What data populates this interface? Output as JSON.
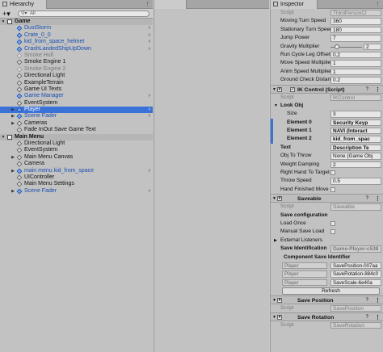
{
  "hierarchy": {
    "tab_label": "Hierarchy",
    "search_placeholder": "All",
    "rows": [
      {
        "label": "Game",
        "style": "scene",
        "indent": 0,
        "arrow": "▼"
      },
      {
        "label": "DustStorm",
        "style": "prefab",
        "indent": 1,
        "arrow": "",
        "chev": "›"
      },
      {
        "label": "Crate_0_0",
        "style": "prefab",
        "indent": 1,
        "arrow": "",
        "chev": "›"
      },
      {
        "label": "kid_from_space_helmet",
        "style": "prefab",
        "indent": 1,
        "arrow": "",
        "chev": "›"
      },
      {
        "label": "CrashLandedShipUpDown",
        "style": "prefab",
        "indent": 1,
        "arrow": "",
        "chev": "›"
      },
      {
        "label": "Smoke Hull",
        "style": "dim",
        "indent": 1,
        "arrow": "",
        "chev": ""
      },
      {
        "label": "Smoke Engine 1",
        "style": "normal",
        "indent": 1,
        "arrow": "",
        "chev": ""
      },
      {
        "label": "Smoke Engine 2",
        "style": "dim",
        "indent": 1,
        "arrow": "",
        "chev": ""
      },
      {
        "label": "Directional Light",
        "style": "normal",
        "indent": 1,
        "arrow": "",
        "chev": ""
      },
      {
        "label": "ExampleTerrain",
        "style": "normal",
        "indent": 1,
        "arrow": "",
        "chev": ""
      },
      {
        "label": "Game UI Texts",
        "style": "normal",
        "indent": 1,
        "arrow": "",
        "chev": ""
      },
      {
        "label": "Game Manager",
        "style": "prefab",
        "indent": 1,
        "arrow": "",
        "chev": "›"
      },
      {
        "label": "EventSystem",
        "style": "normal",
        "indent": 1,
        "arrow": "",
        "chev": ""
      },
      {
        "label": "Player",
        "style": "selected",
        "indent": 1,
        "arrow": "▶",
        "chev": "›"
      },
      {
        "label": "Scene Fader",
        "style": "prefab",
        "indent": 1,
        "arrow": "▶",
        "chev": "›"
      },
      {
        "label": "Cameras",
        "style": "normal",
        "indent": 1,
        "arrow": "▶",
        "chev": ""
      },
      {
        "label": "Fade InOut Save Game Text",
        "style": "normal",
        "indent": 1,
        "arrow": "",
        "chev": ""
      },
      {
        "label": "Main Menu",
        "style": "scene",
        "indent": 0,
        "arrow": "▼"
      },
      {
        "label": "Directional Light",
        "style": "normal",
        "indent": 1,
        "arrow": "",
        "chev": ""
      },
      {
        "label": "EventSystem",
        "style": "normal",
        "indent": 1,
        "arrow": "",
        "chev": ""
      },
      {
        "label": "Main Menu Canvas",
        "style": "normal",
        "indent": 1,
        "arrow": "▶",
        "chev": ""
      },
      {
        "label": "Camera",
        "style": "normal",
        "indent": 1,
        "arrow": "",
        "chev": ""
      },
      {
        "label": "main menu kid_from_space",
        "style": "prefab",
        "indent": 1,
        "arrow": "▶",
        "chev": "›"
      },
      {
        "label": "UIController",
        "style": "normal",
        "indent": 1,
        "arrow": "",
        "chev": ""
      },
      {
        "label": "Main Menu Settings",
        "style": "normal",
        "indent": 1,
        "arrow": "",
        "chev": ""
      },
      {
        "label": "Scene Fader",
        "style": "prefab",
        "indent": 1,
        "arrow": "▶",
        "chev": "›"
      }
    ]
  },
  "inspector": {
    "tab_label": "Inspector",
    "third_person": {
      "script_label": "Script",
      "script_value": "ThirdPersonCl",
      "fields": [
        {
          "k": "Moving Turn Speed",
          "v": "360"
        },
        {
          "k": "Stationary Turn Speed",
          "v": "180"
        },
        {
          "k": "Jump Power",
          "v": "7"
        }
      ],
      "gravity_label": "Gravity Multiplier",
      "gravity_value": "2",
      "gravity_fraction": 0.2,
      "fields2": [
        {
          "k": "Run Cycle Leg Offset",
          "v": "0.2"
        },
        {
          "k": "Move Speed Multiplier",
          "v": "1"
        },
        {
          "k": "Anim Speed Multiplier",
          "v": "1"
        },
        {
          "k": "Ground Check Distance",
          "v": "0.2"
        }
      ]
    },
    "ik_control": {
      "title": "IK Control (Script)",
      "script_label": "Script",
      "script_value": "IKControl",
      "look_obj": "Look Obj",
      "size_label": "Size",
      "size_value": "3",
      "elements": [
        {
          "k": "Element 0",
          "v": "Security Keyp"
        },
        {
          "k": "Element 1",
          "v": "NAVI (Interact"
        },
        {
          "k": "Element 2",
          "v": "kid_from_spac"
        }
      ],
      "text_label": "Text",
      "text_value": "Description Te",
      "obj_to_throw_label": "Obj To Throw",
      "obj_to_throw_value": "None (Game Obj",
      "weight_label": "Weight Damping",
      "weight_value": "2",
      "right_hand_label": "Right Hand To Target",
      "throw_speed_label": "Throw Speed",
      "throw_speed_value": "0.5",
      "hand_finished_label": "Hand Finished Move"
    },
    "saveable": {
      "title": "Saveable",
      "script_label": "Script",
      "script_value": "Saveable",
      "save_config": "Save configuration",
      "load_once": "Load Once",
      "manual_save_load": "Manual Save Load",
      "external_listeners": "External Listeners",
      "save_identification_label": "Save Identification",
      "save_identification_value": "Game-Player-c538",
      "component_save_identifier": "Component Save Identifier",
      "components": [
        {
          "obj": "Player",
          "id": "SavePosition-007aa"
        },
        {
          "obj": "Player",
          "id": "SaveRotation-884c0"
        },
        {
          "obj": "Player",
          "id": "SaveScale-6e40a"
        }
      ],
      "refresh": "Refresh"
    },
    "save_position": {
      "title": "Save Position",
      "script_label": "Script",
      "script_value": "SavePosition"
    },
    "save_rotation": {
      "title": "Save Rotation",
      "script_label": "Script",
      "script_value": "SaveRotation"
    }
  }
}
